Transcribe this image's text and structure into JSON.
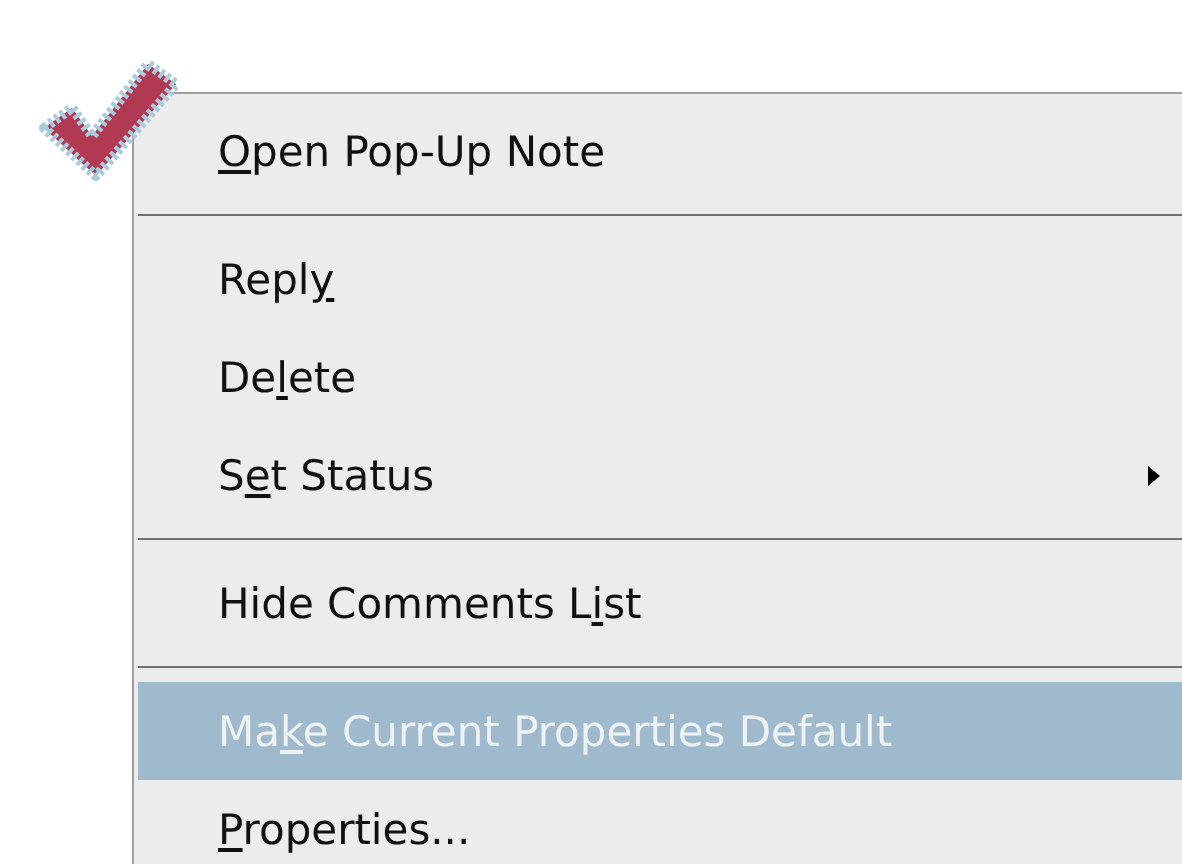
{
  "menu": {
    "items": [
      {
        "kind": "item",
        "access_key": "O",
        "after": "pen Pop-Up Note",
        "disabled": false,
        "selected": false,
        "submenu": false
      },
      {
        "kind": "separator"
      },
      {
        "kind": "item",
        "before": "Repl",
        "access_key": "y",
        "disabled": false,
        "selected": false,
        "submenu": false
      },
      {
        "kind": "item",
        "before": "De",
        "access_key": "l",
        "after": "ete",
        "disabled": false,
        "selected": false,
        "submenu": false
      },
      {
        "kind": "item",
        "before": "S",
        "access_key": "e",
        "after": "t Status",
        "disabled": false,
        "selected": false,
        "submenu": true
      },
      {
        "kind": "separator"
      },
      {
        "kind": "item",
        "before": "Hide Comments L",
        "access_key": "i",
        "after": "st",
        "disabled": false,
        "selected": false,
        "submenu": false
      },
      {
        "kind": "separator"
      },
      {
        "kind": "item",
        "before": "Ma",
        "access_key": "k",
        "after": "e Current Properties Default",
        "disabled": true,
        "selected": true,
        "submenu": false
      },
      {
        "kind": "item",
        "access_key": "P",
        "after": "roperties...",
        "disabled": false,
        "selected": false,
        "submenu": false
      }
    ]
  }
}
